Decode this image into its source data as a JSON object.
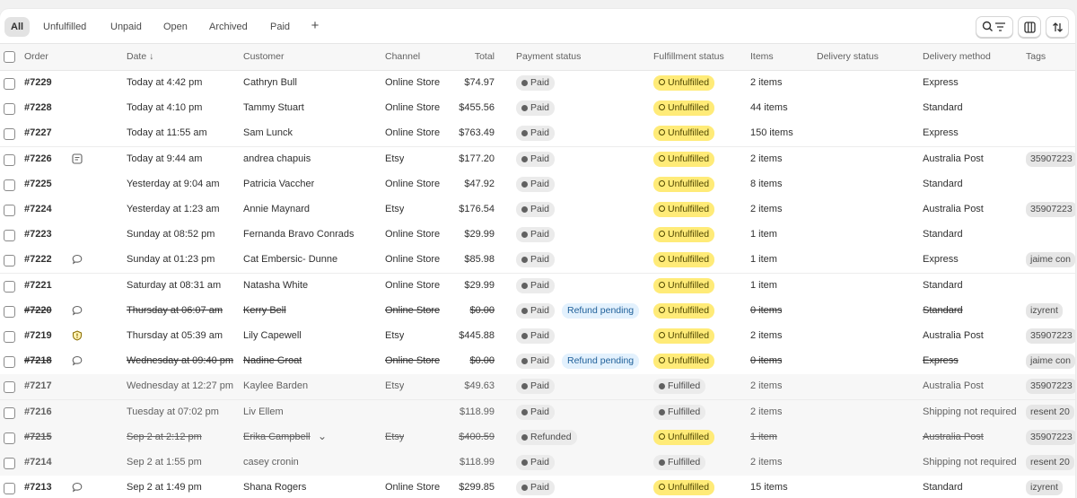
{
  "tabs": {
    "items": [
      "All",
      "Unfulfilled",
      "Unpaid",
      "Open",
      "Archived",
      "Paid"
    ],
    "active": "All",
    "add_label": "+"
  },
  "toolbar": {
    "search_filter_icon": "search-filter-icon",
    "columns_icon": "columns-icon",
    "sort_icon": "sort-icon"
  },
  "columns": {
    "order": "Order",
    "date": "Date ↓",
    "customer": "Customer",
    "channel": "Channel",
    "total": "Total",
    "payment": "Payment status",
    "fulfillment": "Fulfillment status",
    "items": "Items",
    "delivery_status": "Delivery status",
    "delivery_method": "Delivery method",
    "tags": "Tags"
  },
  "orders": [
    {
      "order": "#7229",
      "note": "",
      "date": "Today at 4:42 pm",
      "customer": "Cathryn Bull",
      "channel": "Online Store",
      "total": "$74.97",
      "payment": "Paid",
      "refund": "",
      "fulfillment": "Unfulfilled",
      "items": "2 items",
      "method": "Express",
      "tag": "",
      "state": "normal"
    },
    {
      "order": "#7228",
      "note": "",
      "date": "Today at 4:10 pm",
      "customer": "Tammy Stuart",
      "channel": "Online Store",
      "total": "$455.56",
      "payment": "Paid",
      "refund": "",
      "fulfillment": "Unfulfilled",
      "items": "44 items",
      "method": "Standard",
      "tag": "",
      "state": "normal"
    },
    {
      "order": "#7227",
      "note": "",
      "date": "Today at 11:55 am",
      "customer": "Sam Lunck",
      "channel": "Online Store",
      "total": "$763.49",
      "payment": "Paid",
      "refund": "",
      "fulfillment": "Unfulfilled",
      "items": "150 items",
      "method": "Express",
      "tag": "",
      "state": "normal"
    },
    {
      "order": "#7226",
      "note": "note-icon",
      "date": "Today at 9:44 am",
      "customer": "andrea chapuis",
      "channel": "Etsy",
      "total": "$177.20",
      "payment": "Paid",
      "refund": "",
      "fulfillment": "Unfulfilled",
      "items": "2 items",
      "method": "Australia Post",
      "tag": "35907223",
      "state": "normal"
    },
    {
      "order": "#7225",
      "note": "",
      "date": "Yesterday at 9:04 am",
      "customer": "Patricia Vaccher",
      "channel": "Online Store",
      "total": "$47.92",
      "payment": "Paid",
      "refund": "",
      "fulfillment": "Unfulfilled",
      "items": "8 items",
      "method": "Standard",
      "tag": "",
      "state": "normal"
    },
    {
      "order": "#7224",
      "note": "",
      "date": "Yesterday at 1:23 am",
      "customer": "Annie Maynard",
      "channel": "Etsy",
      "total": "$176.54",
      "payment": "Paid",
      "refund": "",
      "fulfillment": "Unfulfilled",
      "items": "2 items",
      "method": "Australia Post",
      "tag": "35907223",
      "state": "normal"
    },
    {
      "order": "#7223",
      "note": "",
      "date": "Sunday at 08:52 pm",
      "customer": "Fernanda Bravo Conrads",
      "channel": "Online Store",
      "total": "$29.99",
      "payment": "Paid",
      "refund": "",
      "fulfillment": "Unfulfilled",
      "items": "1 item",
      "method": "Standard",
      "tag": "",
      "state": "normal"
    },
    {
      "order": "#7222",
      "note": "comment-icon",
      "date": "Sunday at 01:23 pm",
      "customer": "Cat Embersic- Dunne",
      "channel": "Online Store",
      "total": "$85.98",
      "payment": "Paid",
      "refund": "",
      "fulfillment": "Unfulfilled",
      "items": "1 item",
      "method": "Express",
      "tag": "jaime con",
      "state": "normal"
    },
    {
      "order": "#7221",
      "note": "",
      "date": "Saturday at 08:31 am",
      "customer": "Natasha White",
      "channel": "Online Store",
      "total": "$29.99",
      "payment": "Paid",
      "refund": "",
      "fulfillment": "Unfulfilled",
      "items": "1 item",
      "method": "Standard",
      "tag": "",
      "state": "normal"
    },
    {
      "order": "#7220",
      "note": "comment-icon",
      "date": "Thursday at 06:07 am",
      "customer": "Kerry Bell",
      "channel": "Online Store",
      "total": "$0.00",
      "payment": "Paid",
      "refund": "Refund pending",
      "fulfillment": "Unfulfilled",
      "items": "0 items",
      "method": "Standard",
      "tag": "izyrent",
      "state": "cancelled"
    },
    {
      "order": "#7219",
      "note": "alert-icon",
      "date": "Thursday at 05:39 am",
      "customer": "Lily Capewell",
      "channel": "Etsy",
      "total": "$445.88",
      "payment": "Paid",
      "refund": "",
      "fulfillment": "Unfulfilled",
      "items": "2 items",
      "method": "Australia Post",
      "tag": "35907223",
      "state": "normal"
    },
    {
      "order": "#7218",
      "note": "comment-icon",
      "date": "Wednesday at 09:40 pm",
      "customer": "Nadine Groat",
      "channel": "Online Store",
      "total": "$0.00",
      "payment": "Paid",
      "refund": "Refund pending",
      "fulfillment": "Unfulfilled",
      "items": "0 items",
      "method": "Express",
      "tag": "jaime con",
      "state": "cancelled"
    },
    {
      "order": "#7217",
      "note": "",
      "date": "Wednesday at 12:27 pm",
      "customer": "Kaylee Barden",
      "channel": "Etsy",
      "total": "$49.63",
      "payment": "Paid",
      "refund": "",
      "fulfillment": "Fulfilled",
      "items": "2 items",
      "method": "Australia Post",
      "tag": "35907223",
      "state": "muted"
    },
    {
      "order": "#7216",
      "note": "",
      "date": "Tuesday at 07:02 pm",
      "customer": "Liv Ellem",
      "channel": "",
      "total": "$118.99",
      "payment": "Paid",
      "refund": "",
      "fulfillment": "Fulfilled",
      "items": "2 items",
      "method": "Shipping not required",
      "tag": "resent 20",
      "state": "muted"
    },
    {
      "order": "#7215",
      "note": "",
      "date": "Sep 2 at 2:12 pm",
      "customer": "Erika Campbell",
      "channel": "Etsy",
      "total": "$400.59",
      "payment": "Refunded",
      "refund": "",
      "fulfillment": "Unfulfilled",
      "items": "1 item",
      "method": "Australia Post",
      "tag": "35907223",
      "state": "cancelled-muted",
      "chevron": "⌄"
    },
    {
      "order": "#7214",
      "note": "",
      "date": "Sep 2 at 1:55 pm",
      "customer": "casey cronin",
      "channel": "",
      "total": "$118.99",
      "payment": "Paid",
      "refund": "",
      "fulfillment": "Fulfilled",
      "items": "2 items",
      "method": "Shipping not required",
      "tag": "resent 20",
      "state": "muted"
    },
    {
      "order": "#7213",
      "note": "comment-icon",
      "date": "Sep 2 at 1:49 pm",
      "customer": "Shana Rogers",
      "channel": "Online Store",
      "total": "$299.85",
      "payment": "Paid",
      "refund": "",
      "fulfillment": "Unfulfilled",
      "items": "15 items",
      "method": "Standard",
      "tag": "izyrent",
      "state": "normal"
    }
  ]
}
